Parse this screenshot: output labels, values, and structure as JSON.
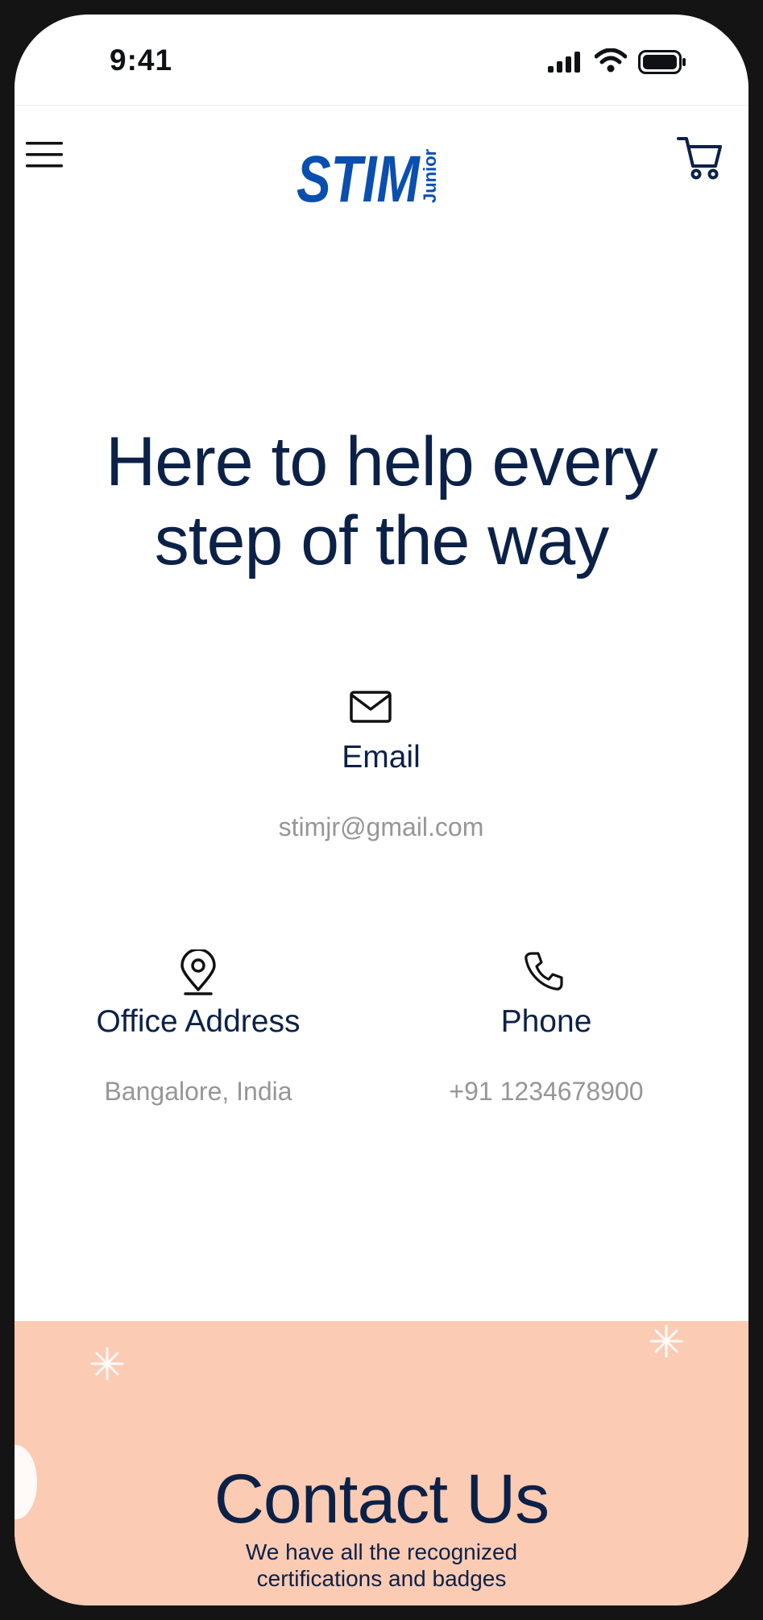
{
  "status_bar": {
    "time": "9:41"
  },
  "header": {
    "logo_text": "STIM",
    "logo_subtext": "Junior",
    "brand_color": "#0a4fb0"
  },
  "hero": {
    "headline": "Here to help every step of the way"
  },
  "contact_info": {
    "email": {
      "icon": "mail-icon",
      "label": "Email",
      "value": "stimjr@gmail.com"
    },
    "address": {
      "icon": "map-pin-icon",
      "label": "Office Address",
      "value": "Bangalore, India"
    },
    "phone": {
      "icon": "phone-icon",
      "label": "Phone",
      "value": "+91 1234678900"
    }
  },
  "contact_section": {
    "title": "Contact Us",
    "subtitle": "We have all the recognized certifications and badges",
    "background": "#fbcbb4"
  },
  "colors": {
    "text_dark": "#0c2147",
    "text_muted": "#969696",
    "accent": "#0a4fb0"
  }
}
